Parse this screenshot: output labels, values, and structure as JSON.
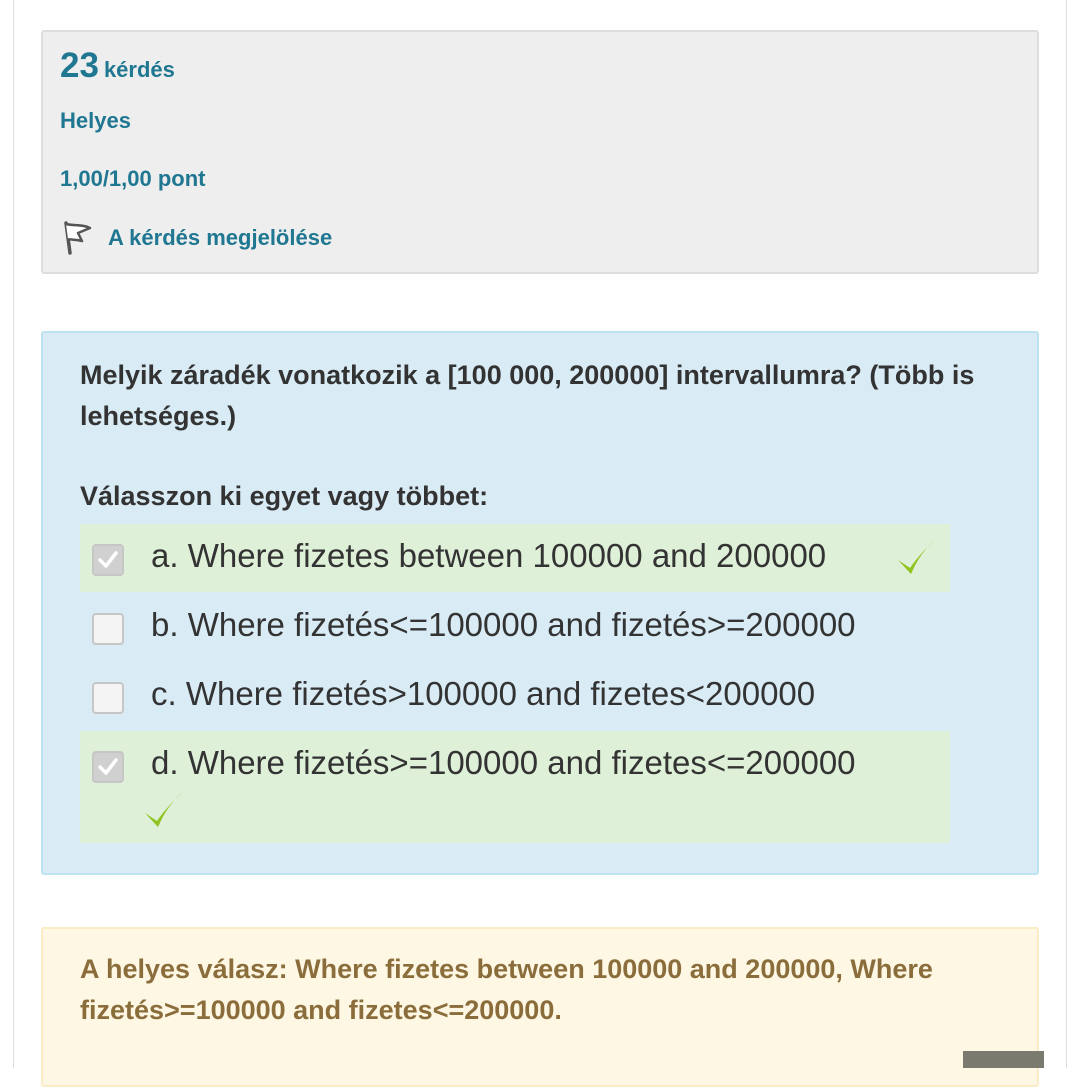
{
  "info": {
    "question_number": "23",
    "question_label": "kérdés",
    "state": "Helyes",
    "grade": "1,00/1,00 pont",
    "flag_label": "A kérdés megjelölése",
    "flag_icon": "flag-icon"
  },
  "question": {
    "text": "Melyik záradék vonatkozik a [100 000, 200000] intervallumra? (Több is lehetséges.)",
    "prompt": "Válasszon ki egyet vagy többet:",
    "options": [
      {
        "label": "a. Where fizetes between 100000 and 200000",
        "checked": true,
        "correct": true
      },
      {
        "label": "b. Where fizetés<=100000 and fizetés>=200000",
        "checked": false,
        "correct": false
      },
      {
        "label": "c. Where fizetés>100000 and fizetes<200000",
        "checked": false,
        "correct": false
      },
      {
        "label": "d. Where fizetés>=100000 and fizetes<=200000",
        "checked": true,
        "correct": true
      }
    ]
  },
  "feedback": {
    "right_answer": "A helyes válasz: Where fizetes between 100000 and 200000, Where fizetés>=100000 and fizetes<=200000."
  },
  "colors": {
    "link": "#1f7791",
    "correct_bg": "#dff0d8",
    "content_bg": "#d9ecf6",
    "feedback_text": "#8a6d3b",
    "tick": "#8fc31f"
  }
}
